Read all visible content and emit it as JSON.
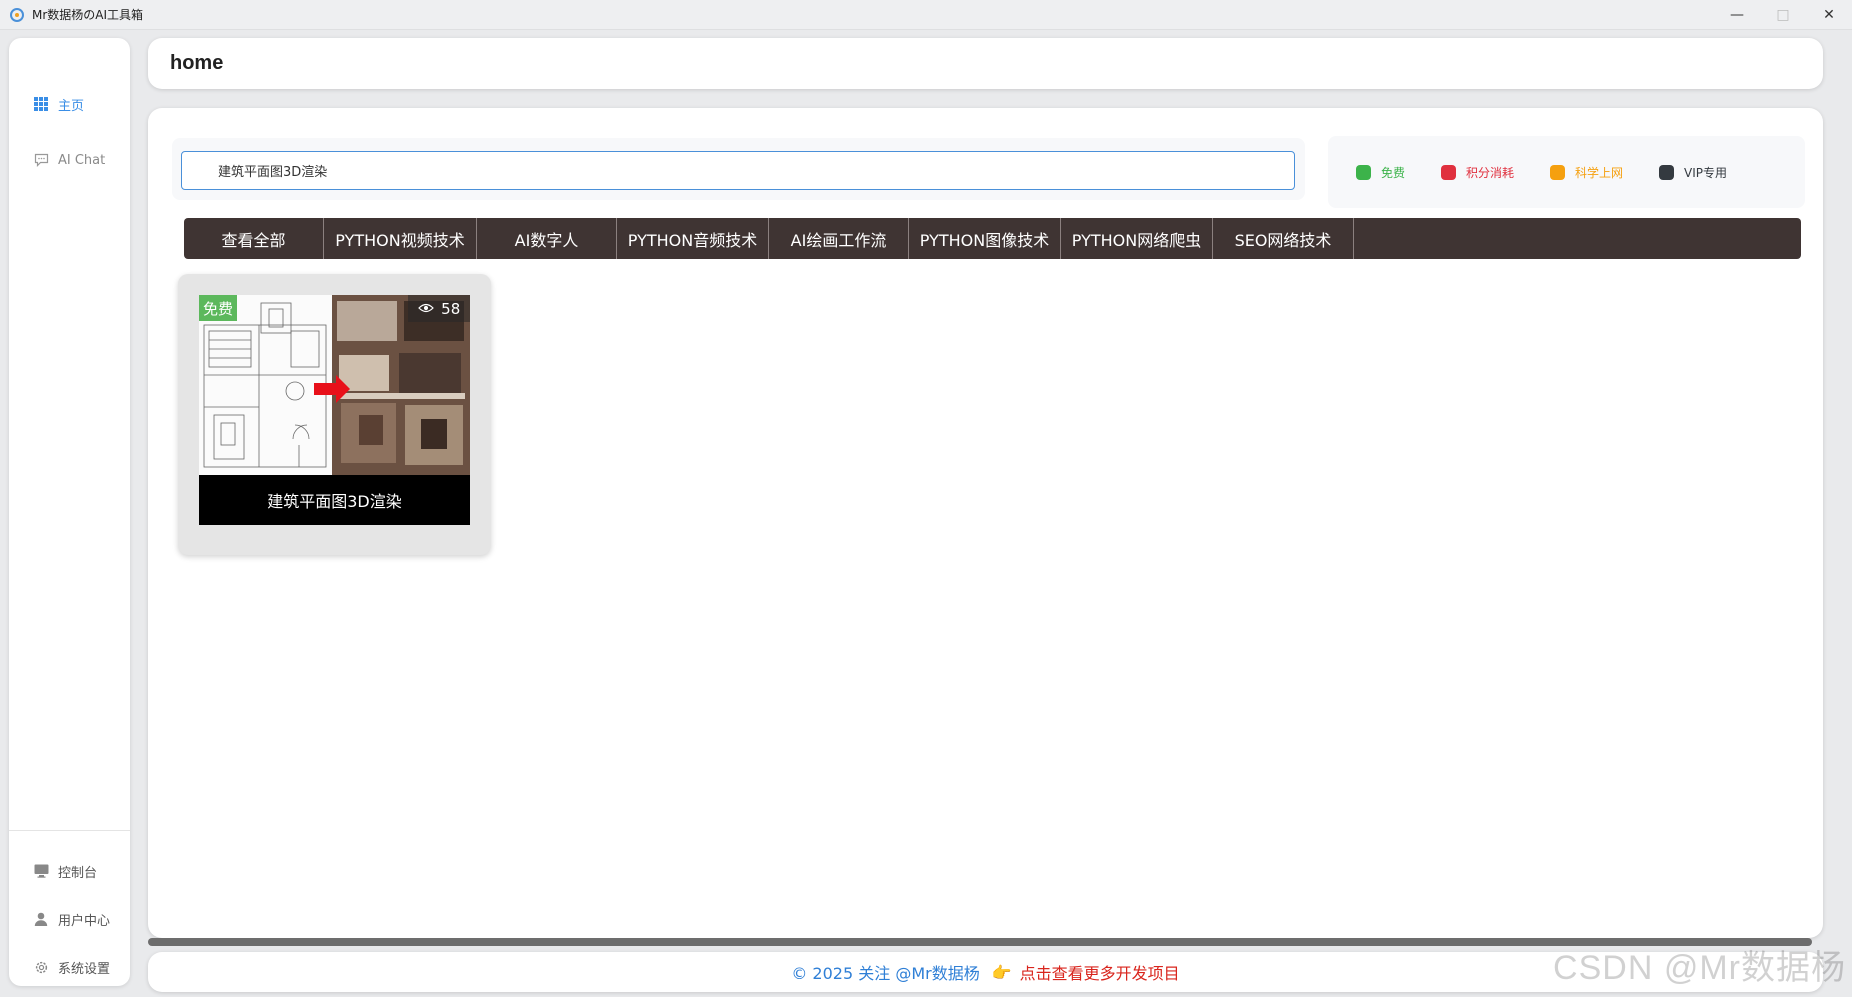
{
  "window": {
    "title": "Mr数据杨のAI工具箱",
    "minimize": "—",
    "maximize": "□",
    "close": "✕"
  },
  "sidebar": {
    "top_items": [
      {
        "label": "主页",
        "icon": "grid-icon"
      },
      {
        "label": "AI Chat",
        "icon": "chat-icon"
      }
    ],
    "bottom_items": [
      {
        "label": "控制台",
        "icon": "monitor-icon"
      },
      {
        "label": "用户中心",
        "icon": "user-icon"
      },
      {
        "label": "系统设置",
        "icon": "gear-icon"
      }
    ]
  },
  "header": {
    "title": "home"
  },
  "search": {
    "value": "建筑平面图3D渲染"
  },
  "legend": [
    {
      "label": "免费",
      "color": "#3cb34a"
    },
    {
      "label": "积分消耗",
      "color": "#e0303e"
    },
    {
      "label": "科学上网",
      "color": "#f5a00f"
    },
    {
      "label": "VIP专用",
      "color": "#343a40"
    }
  ],
  "categories": [
    "查看全部",
    "PYTHON视频技术",
    "AI数字人",
    "PYTHON音频技术",
    "AI绘画工作流",
    "PYTHON图像技术",
    "PYTHON网络爬虫",
    "SEO网络技术"
  ],
  "cards": [
    {
      "title": "建筑平面图3D渲染",
      "badge": "免费",
      "views": "58"
    }
  ],
  "footer": {
    "copyright": "© 2025 关注 @Mr数据杨",
    "hand": "👉",
    "link": "点击查看更多开发项目"
  },
  "watermark": "CSDN @Mr数据杨",
  "colors": {
    "accent": "#3a8ee6",
    "category_bar": "#3f3433",
    "free_badge": "#5cb85c"
  }
}
